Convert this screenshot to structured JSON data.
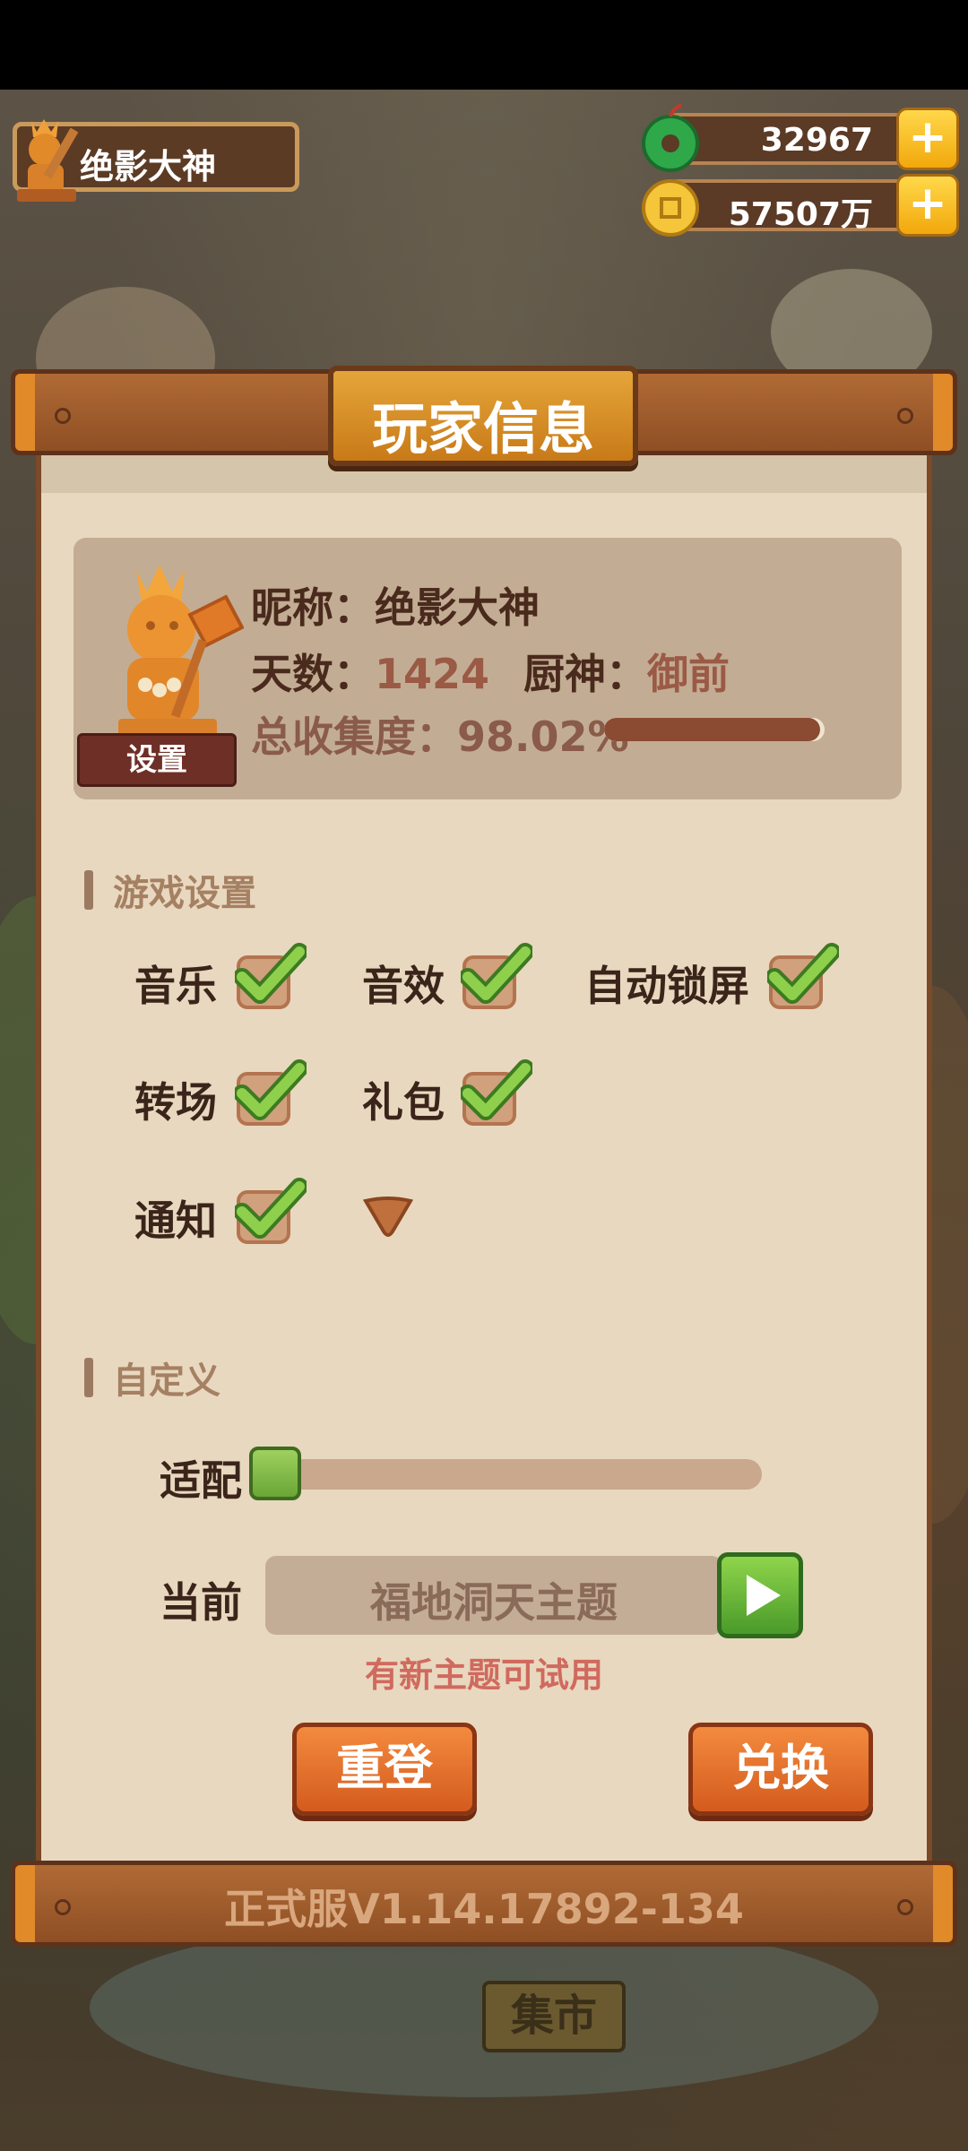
{
  "player": {
    "name": "绝影大神"
  },
  "currency": {
    "jade": {
      "icon": "jade-icon",
      "value": "32967"
    },
    "coins": {
      "icon": "coin-icon",
      "value": "57507万"
    }
  },
  "dialog": {
    "title": "玩家信息",
    "info": {
      "nickname_label": "昵称：",
      "nickname": "绝影大神",
      "days_label": "天数：",
      "days": "1424",
      "chef_label": "厨神：",
      "chef": "御前",
      "collection_label": "总收集度：",
      "collection": "98.02%",
      "collection_fraction": 0.9802,
      "settings_button": "设置"
    },
    "game_settings": {
      "heading": "游戏设置",
      "options": [
        {
          "label": "音乐",
          "checked": true
        },
        {
          "label": "音效",
          "checked": true
        },
        {
          "label": "自动锁屏",
          "checked": true
        },
        {
          "label": "转场",
          "checked": true
        },
        {
          "label": "礼包",
          "checked": true
        },
        {
          "label": "通知",
          "checked": true
        }
      ]
    },
    "custom": {
      "heading": "自定义",
      "fit_label": "适配",
      "fit_value": 0.0,
      "current_label": "当前",
      "current_theme": "福地洞天主题",
      "hint": "有新主题可试用"
    },
    "buttons": {
      "relogin": "重登",
      "redeem": "兑换"
    },
    "version": "正式服V1.14.17892-134"
  },
  "background": {
    "market_sign": "集市"
  },
  "colors": {
    "accent": "#d45b1e",
    "check": "#6aa636",
    "panel": "#e8d8bf",
    "wood": "#8f4f24"
  }
}
